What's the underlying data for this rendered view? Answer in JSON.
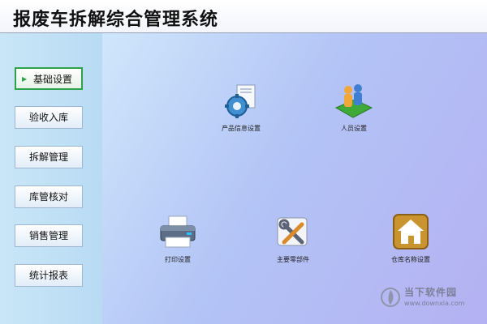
{
  "app": {
    "title": "报废车拆解综合管理系统"
  },
  "sidebar": {
    "items": [
      {
        "label": "基础设置",
        "active": true
      },
      {
        "label": "验收入库",
        "active": false
      },
      {
        "label": "拆解管理",
        "active": false
      },
      {
        "label": "库管核对",
        "active": false
      },
      {
        "label": "销售管理",
        "active": false
      },
      {
        "label": "统计报表",
        "active": false
      }
    ]
  },
  "main": {
    "tiles": [
      {
        "label": "产品信息设置",
        "icon": "gear-document-icon"
      },
      {
        "label": "人员设置",
        "icon": "people-icon"
      },
      {
        "label": "打印设置",
        "icon": "printer-icon"
      },
      {
        "label": "主要零部件",
        "icon": "tools-icon"
      },
      {
        "label": "仓库名称设置",
        "icon": "warehouse-home-icon"
      }
    ]
  },
  "watermark": {
    "text": "当下软件园",
    "url": "www.downxia.com"
  },
  "colors": {
    "active_border": "#2fa14b",
    "sidebar_bg": "#c9e6f7",
    "content_bg": "#b3c4f6"
  }
}
